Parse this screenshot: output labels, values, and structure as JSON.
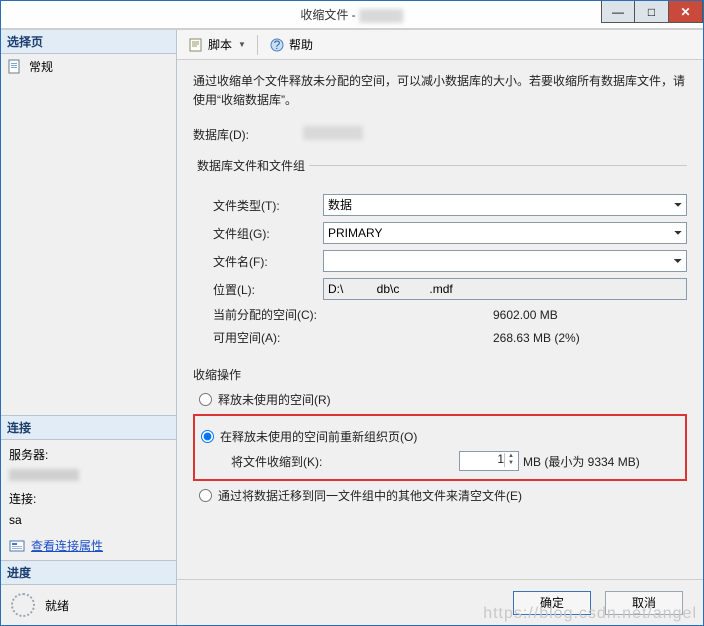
{
  "title": "收缩文件 -",
  "win": {
    "min": "—",
    "max": "□",
    "close": "✕"
  },
  "left": {
    "select_page_header": "选择页",
    "general": "常规",
    "connection_header": "连接",
    "server_label": "服务器:",
    "conn_label": "连接:",
    "conn_user": "sa",
    "view_props_link": "查看连接属性",
    "progress_header": "进度",
    "progress_status": "就绪"
  },
  "toolbar": {
    "script": "脚本",
    "help": "帮助"
  },
  "main": {
    "description": "通过收缩单个文件释放未分配的空间，可以减小数据库的大小。若要收缩所有数据库文件，请使用“收缩数据库”。",
    "db_label": "数据库(D):",
    "fieldset_legend": "数据库文件和文件组",
    "file_type_label": "文件类型(T):",
    "file_type_value": "数据",
    "filegroup_label": "文件组(G):",
    "filegroup_value": "PRIMARY",
    "filename_label": "文件名(F):",
    "filename_value": "",
    "location_label": "位置(L):",
    "location_value": "D:\\          db\\c         .mdf",
    "alloc_label": "当前分配的空间(C):",
    "alloc_value": "9602.00 MB",
    "avail_label": "可用空间(A):",
    "avail_value": "268.63 MB (2%)",
    "shrink_section": "收缩操作",
    "radio_release": "释放未使用的空间(R)",
    "radio_reorg": "在释放未使用的空间前重新组织页(O)",
    "shrink_to_label": "将文件收缩到(K):",
    "shrink_to_value": "1",
    "shrink_to_suffix": "MB (最小为 9334 MB)",
    "radio_empty": "通过将数据迁移到同一文件组中的其他文件来清空文件(E)"
  },
  "footer": {
    "ok": "确定",
    "cancel": "取消"
  },
  "watermark": "https://blog.csdn.net/angel"
}
